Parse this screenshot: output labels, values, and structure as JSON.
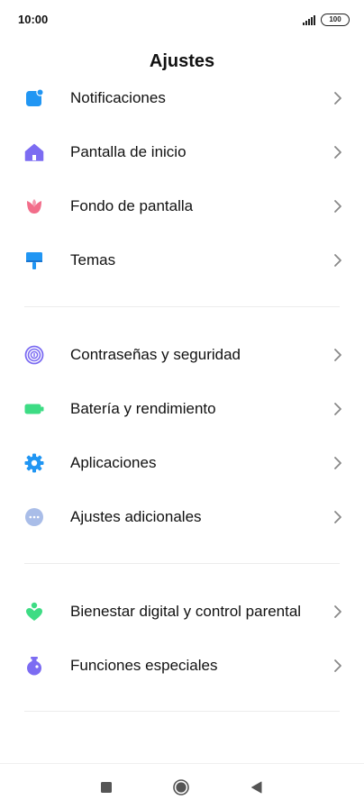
{
  "status_bar": {
    "time": "10:00",
    "battery": "100"
  },
  "header": {
    "title": "Ajustes"
  },
  "sections": [
    [
      {
        "label": "Notificaciones",
        "icon": "notification-icon",
        "color": "#2196f3"
      },
      {
        "label": "Pantalla de inicio",
        "icon": "home-icon",
        "color": "#7c6cf2"
      },
      {
        "label": "Fondo de pantalla",
        "icon": "tulip-icon",
        "color": "#f26d8a"
      },
      {
        "label": "Temas",
        "icon": "paint-brush-icon",
        "color": "#2196f3"
      }
    ],
    [
      {
        "label": "Contraseñas y seguridad",
        "icon": "fingerprint-icon",
        "color": "#7c6cf2"
      },
      {
        "label": "Batería y rendimiento",
        "icon": "battery-icon",
        "color": "#3ddc84"
      },
      {
        "label": "Aplicaciones",
        "icon": "gear-icon",
        "color": "#2196f3"
      },
      {
        "label": "Ajustes adicionales",
        "icon": "more-dots-icon",
        "color": "#a9bde8"
      }
    ],
    [
      {
        "label": "Bienestar digital y control parental",
        "icon": "wellbeing-heart-icon",
        "color": "#3ddc84"
      },
      {
        "label": "Funciones especiales",
        "icon": "potion-icon",
        "color": "#7c6cf2"
      }
    ]
  ],
  "nav_bar": {
    "recent_icon": "recent-apps-icon",
    "home_icon": "home-button-icon",
    "back_icon": "back-icon"
  }
}
